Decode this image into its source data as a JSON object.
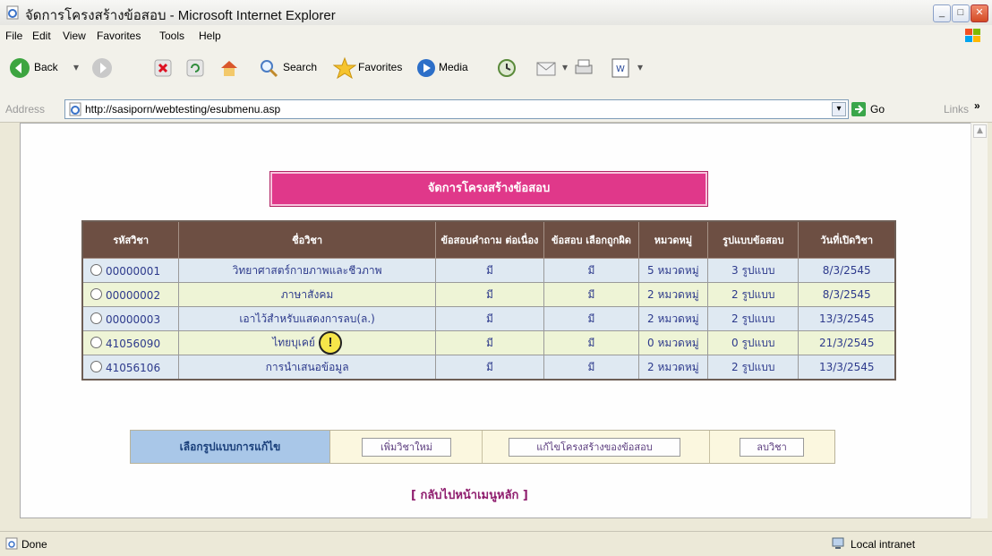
{
  "window": {
    "title": "จัดการโครงสร้างข้อสอบ - Microsoft Internet Explorer"
  },
  "menu": [
    "File",
    "Edit",
    "View",
    "Favorites",
    "Tools",
    "Help"
  ],
  "toolbar": {
    "back": "Back",
    "search": "Search",
    "favorites": "Favorites",
    "media": "Media"
  },
  "address": {
    "label": "Address",
    "url": "http://sasiporn/webtesting/esubmenu.asp",
    "go": "Go",
    "links": "Links"
  },
  "page": {
    "heading": "จัดการโครงสร้างข้อสอบ",
    "table": {
      "headers": [
        "รหัสวิชา",
        "ชื่อวิชา",
        "ข้อสอบคำถาม ต่อเนื่อง",
        "ข้อสอบ เลือกถูกผิด",
        "หมวดหมู่",
        "รูปแบบข้อสอบ",
        "วันที่เปิดวิชา"
      ],
      "rows": [
        [
          "00000001",
          "วิทยาศาสตร์กายภาพและชีวภาพ",
          "มี",
          "มี",
          "5 หมวดหมู่",
          "3 รูปแบบ",
          "8/3/2545"
        ],
        [
          "00000002",
          "ภาษาสังคม",
          "มี",
          "มี",
          "2 หมวดหมู่",
          "2 รูปแบบ",
          "8/3/2545"
        ],
        [
          "00000003",
          "เอาไว้สำหรับแสดงการลบ(ล.)",
          "มี",
          "มี",
          "2 หมวดหมู่",
          "2 รูปแบบ",
          "13/3/2545"
        ],
        [
          "41056090",
          "ไทยบุเคย์",
          "มี",
          "มี",
          "0 หมวดหมู่",
          "0 รูปแบบ",
          "21/3/2545"
        ],
        [
          "41056106",
          "การนำเสนอข้อมูล",
          "มี",
          "มี",
          "2 หมวดหมู่",
          "2 รูปแบบ",
          "13/3/2545"
        ]
      ]
    },
    "actions": {
      "label": "เลือกรูปแบบการแก้ไข",
      "add": "เพิ่มวิชาใหม่",
      "edit": "แก้ไขโครงสร้างของข้อสอบ",
      "delete": "ลบวิชา"
    },
    "back_link": "[ กลับไปหน้าเมนูหลัก ]"
  },
  "status": {
    "left": "Done",
    "zone": "Local intranet"
  }
}
